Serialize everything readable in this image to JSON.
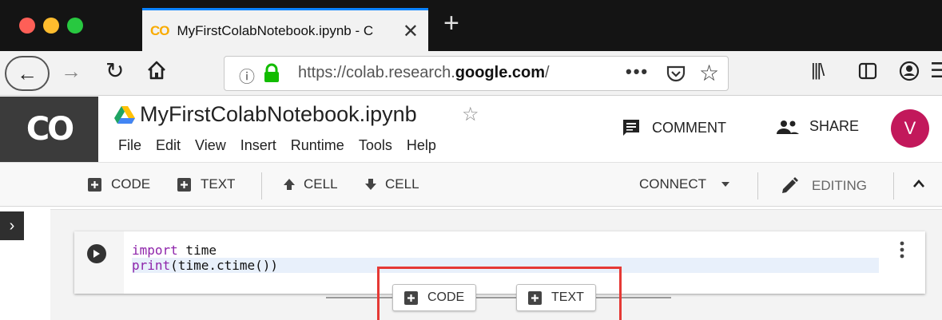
{
  "browser": {
    "tab_title": "MyFirstColabNotebook.ipynb - C",
    "tab_favicon_text": "CO",
    "tab_close": "✕",
    "new_tab": "+",
    "url_prefix": "https://colab.research.",
    "url_domain": "google.com",
    "url_suffix": "/",
    "url_menu": "•••",
    "accent_color": "#0a84ff"
  },
  "colab": {
    "logo_text": "CO",
    "notebook_title": "MyFirstColabNotebook.ipynb",
    "star": "☆",
    "menus": [
      "File",
      "Edit",
      "View",
      "Insert",
      "Runtime",
      "Tools",
      "Help"
    ],
    "comment_label": "COMMENT",
    "share_label": "SHARE",
    "avatar_initial": "V",
    "avatar_color": "#c2185b"
  },
  "toolbar": {
    "code_label": "CODE",
    "text_label": "TEXT",
    "cell_up_label": "CELL",
    "cell_down_label": "CELL",
    "connect_label": "CONNECT",
    "editing_label": "EDITING"
  },
  "cell": {
    "code_lines": [
      {
        "keyword": "import",
        "rest": " time"
      },
      {
        "keyword": "print",
        "rest": "(time.ctime())"
      }
    ]
  },
  "insert": {
    "code_label": "CODE",
    "text_label": "TEXT"
  },
  "icons": {
    "back": "arrow-left-icon",
    "forward": "arrow-right-icon",
    "reload": "reload-icon",
    "home": "home-icon",
    "lock": "lock-icon",
    "pocket": "pocket-icon",
    "bookmark": "star-icon",
    "library": "library-icon",
    "sidebar": "sidebar-icon",
    "account": "account-icon",
    "menu": "hamburger-icon",
    "run": "play-icon"
  }
}
